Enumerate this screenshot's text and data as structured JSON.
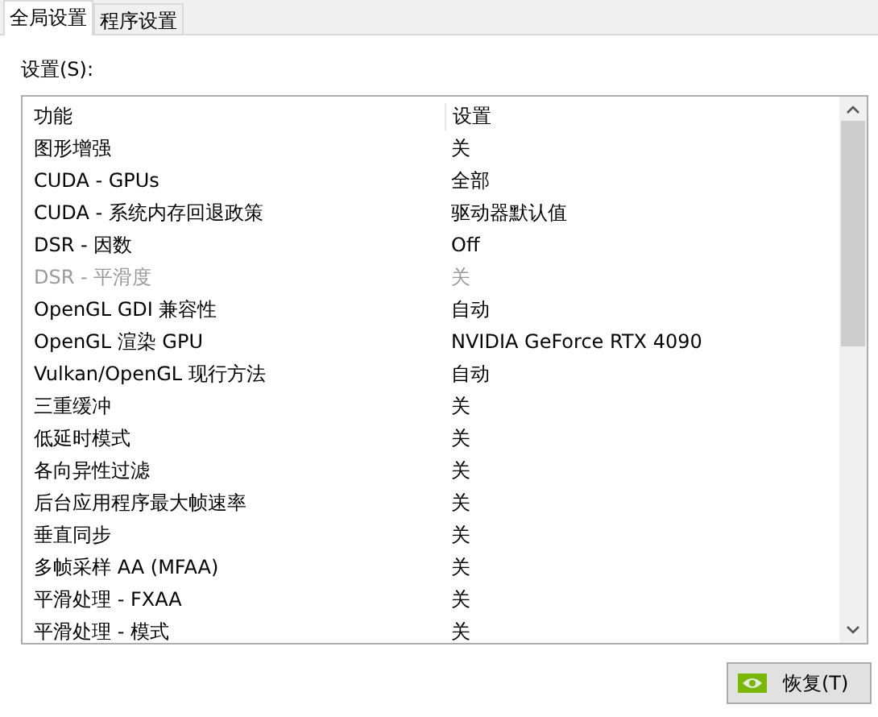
{
  "tabs": [
    {
      "label": "全局设置",
      "selected": true
    },
    {
      "label": "程序设置",
      "selected": false
    }
  ],
  "settings_label": "设置(S):",
  "table": {
    "columns": [
      "功能",
      "设置"
    ],
    "rows": [
      {
        "feature": "图形增强",
        "value": "关",
        "disabled": false
      },
      {
        "feature": "CUDA - GPUs",
        "value": "全部",
        "disabled": false
      },
      {
        "feature": "CUDA - 系统内存回退政策",
        "value": "驱动器默认值",
        "disabled": false
      },
      {
        "feature": "DSR - 因数",
        "value": "Off",
        "disabled": false
      },
      {
        "feature": "DSR - 平滑度",
        "value": "关",
        "disabled": true
      },
      {
        "feature": "OpenGL GDI 兼容性",
        "value": "自动",
        "disabled": false
      },
      {
        "feature": "OpenGL 渲染 GPU",
        "value": "NVIDIA GeForce RTX 4090",
        "disabled": false
      },
      {
        "feature": "Vulkan/OpenGL 现行方法",
        "value": "自动",
        "disabled": false
      },
      {
        "feature": "三重缓冲",
        "value": "关",
        "disabled": false
      },
      {
        "feature": "低延时模式",
        "value": "关",
        "disabled": false
      },
      {
        "feature": "各向异性过滤",
        "value": "关",
        "disabled": false
      },
      {
        "feature": "后台应用程序最大帧速率",
        "value": "关",
        "disabled": false
      },
      {
        "feature": "垂直同步",
        "value": "关",
        "disabled": false
      },
      {
        "feature": "多帧采样 AA (MFAA)",
        "value": "关",
        "disabled": false
      },
      {
        "feature": "平滑处理 - FXAA",
        "value": "关",
        "disabled": false
      },
      {
        "feature": "平滑处理 - 模式",
        "value": "关",
        "disabled": false
      }
    ]
  },
  "restore_button": "恢复(T)"
}
